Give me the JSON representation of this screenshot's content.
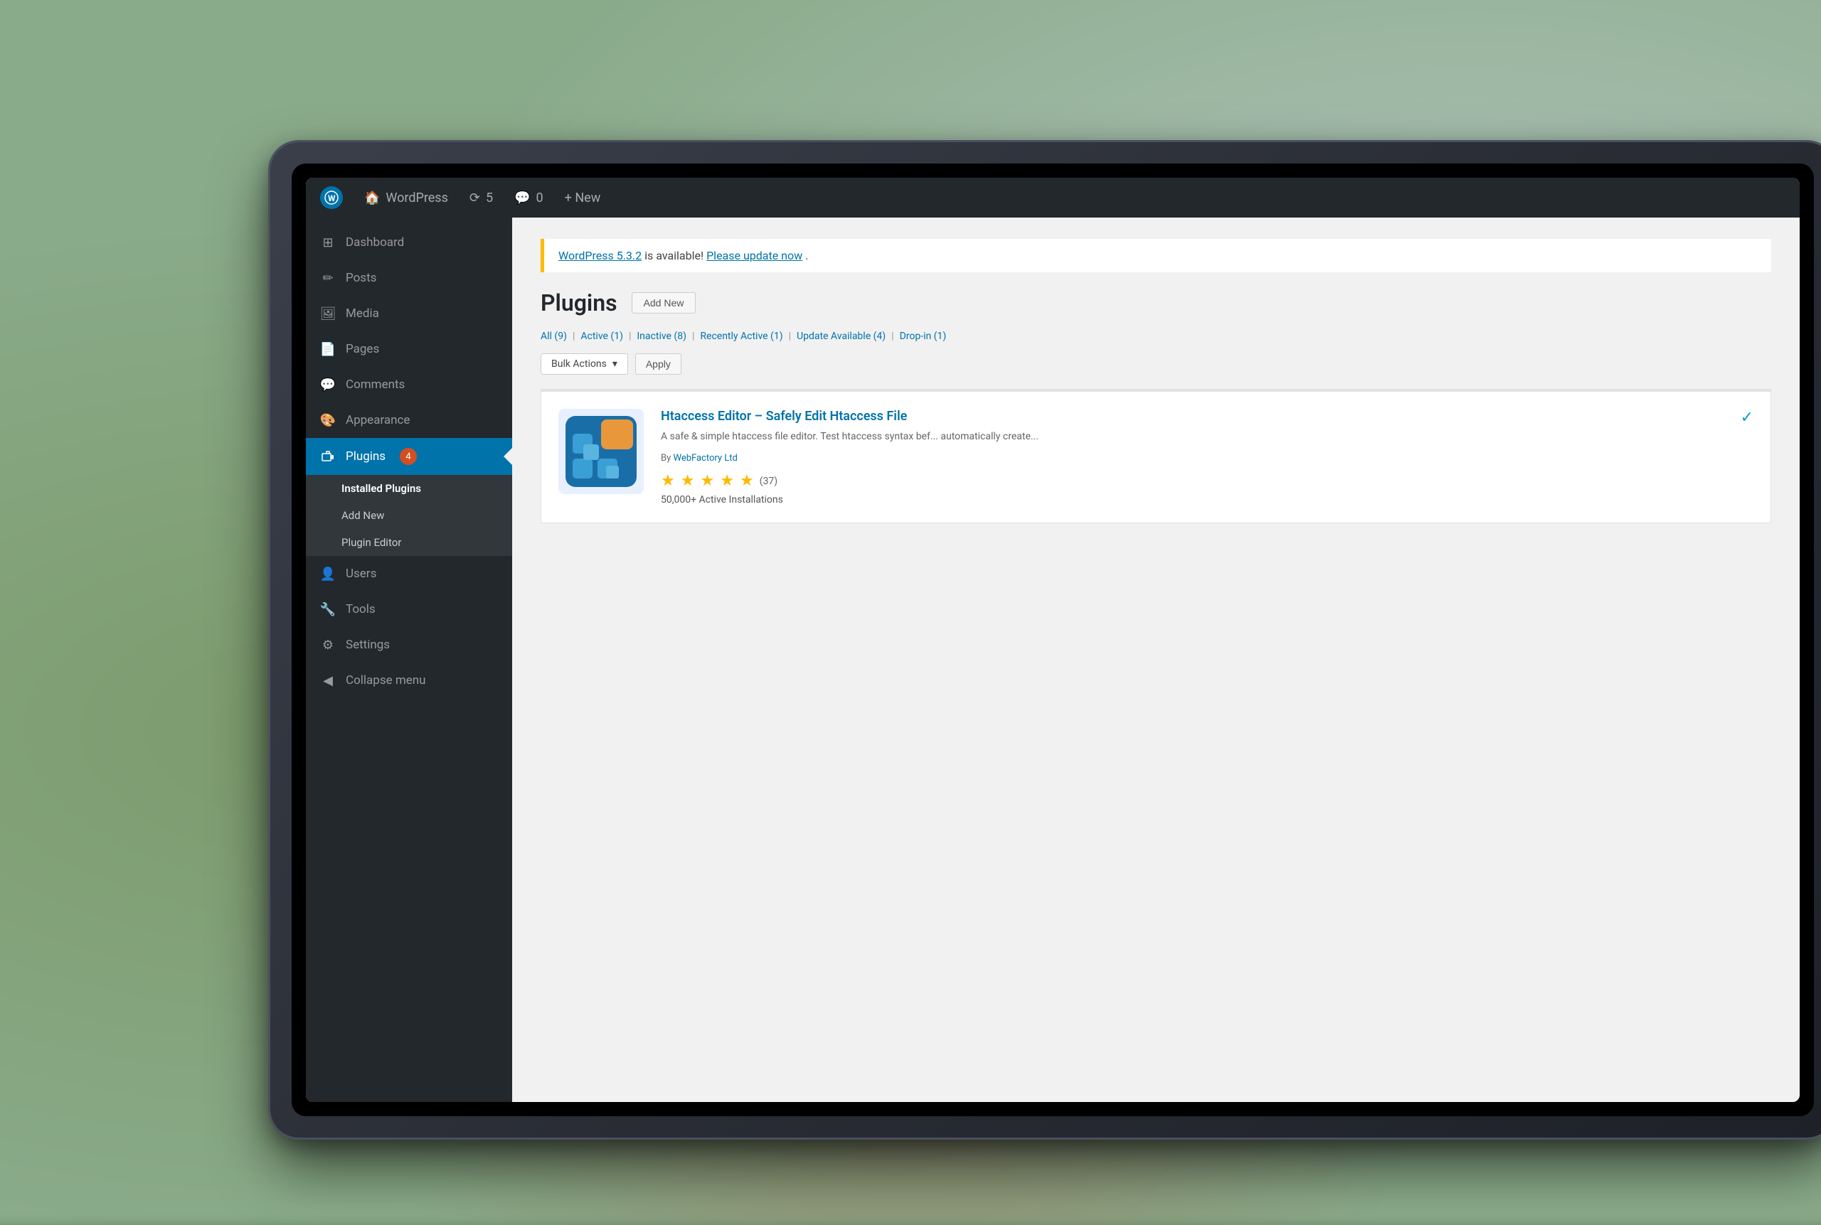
{
  "background": {
    "color": "#8aab8a"
  },
  "adminBar": {
    "wp_icon": "W",
    "site_name": "WordPress",
    "updates_icon": "⟳",
    "updates_count": "5",
    "comments_icon": "💬",
    "comments_count": "0",
    "new_label": "+ New"
  },
  "sidebar": {
    "items": [
      {
        "id": "dashboard",
        "label": "Dashboard",
        "icon": "⊞",
        "active": false
      },
      {
        "id": "posts",
        "label": "Posts",
        "icon": "✏",
        "active": false
      },
      {
        "id": "media",
        "label": "Media",
        "icon": "🖼",
        "active": false
      },
      {
        "id": "pages",
        "label": "Pages",
        "icon": "📄",
        "active": false
      },
      {
        "id": "comments",
        "label": "Comments",
        "icon": "💬",
        "active": false
      },
      {
        "id": "appearance",
        "label": "Appearance",
        "icon": "🎨",
        "active": false
      },
      {
        "id": "plugins",
        "label": "Plugins",
        "badge": "4",
        "icon": "⚙",
        "active": true
      },
      {
        "id": "users",
        "label": "Users",
        "icon": "👤",
        "active": false
      },
      {
        "id": "tools",
        "label": "Tools",
        "icon": "🔧",
        "active": false
      },
      {
        "id": "settings",
        "label": "Settings",
        "icon": "⚙",
        "active": false
      },
      {
        "id": "collapse",
        "label": "Collapse menu",
        "icon": "◀",
        "active": false
      }
    ],
    "submenu": {
      "parent_id": "plugins",
      "items": [
        {
          "id": "installed-plugins",
          "label": "Installed Plugins",
          "active": true
        },
        {
          "id": "add-new",
          "label": "Add New",
          "active": false
        },
        {
          "id": "plugin-editor",
          "label": "Plugin Editor",
          "active": false
        }
      ]
    }
  },
  "content": {
    "update_notice": {
      "version": "WordPress 5.3.2",
      "message": "is available!",
      "link_text": "Please update now",
      "link_suffix": "."
    },
    "page_title": "Plugins",
    "add_new_button": "Add New",
    "filter_links": [
      {
        "id": "all",
        "label": "All",
        "count": "(9)"
      },
      {
        "id": "active",
        "label": "Active",
        "count": "(1)"
      },
      {
        "id": "inactive",
        "label": "Inactive",
        "count": "(8)"
      },
      {
        "id": "recently-active",
        "label": "Recently Active",
        "count": "(1)"
      },
      {
        "id": "update-available",
        "label": "Update Available",
        "count": "(4)"
      },
      {
        "id": "drop-in",
        "label": "Drop-in",
        "count": "(1)"
      }
    ],
    "bulk_actions": {
      "dropdown_label": "Bulk Actions",
      "dropdown_arrow": "▾",
      "apply_button": "Apply"
    },
    "plugins": [
      {
        "id": "htaccess-editor",
        "name": "Htaccess Editor – Safely Edit Htaccess File",
        "description": "A safe & simple htaccess file editor. Test htaccess syntax bef... automatically create...",
        "author": "WebFactory Ltd",
        "rating": 5,
        "review_count": "(37)",
        "install_count": "50,000+ Active Installations",
        "active": true
      }
    ]
  }
}
